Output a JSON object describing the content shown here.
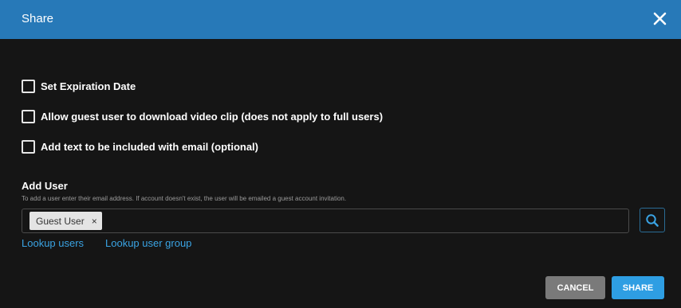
{
  "dialog": {
    "title": "Share"
  },
  "options": [
    {
      "label": "Set Expiration Date",
      "checked": false
    },
    {
      "label": "Allow guest user to download video clip (does not apply to full users)",
      "checked": false
    },
    {
      "label": "Add text to be included with email (optional)",
      "checked": false
    }
  ],
  "add_user": {
    "title": "Add User",
    "helper": "To add a user enter their email address. If account doesn't exist, the user will be emailed a guest account invitation.",
    "chips": [
      {
        "label": "Guest User",
        "remove": "×"
      }
    ]
  },
  "links": {
    "lookup_users": "Lookup users",
    "lookup_user_group": "Lookup user group"
  },
  "buttons": {
    "cancel": "CANCEL",
    "share": "SHARE"
  },
  "colors": {
    "header": "#2779b8",
    "background": "#151515",
    "link": "#3aa3e3",
    "share_button": "#2e9ee3",
    "cancel_button": "#7a7a7a"
  },
  "icons": {
    "close": "close-icon",
    "search": "search-icon"
  }
}
